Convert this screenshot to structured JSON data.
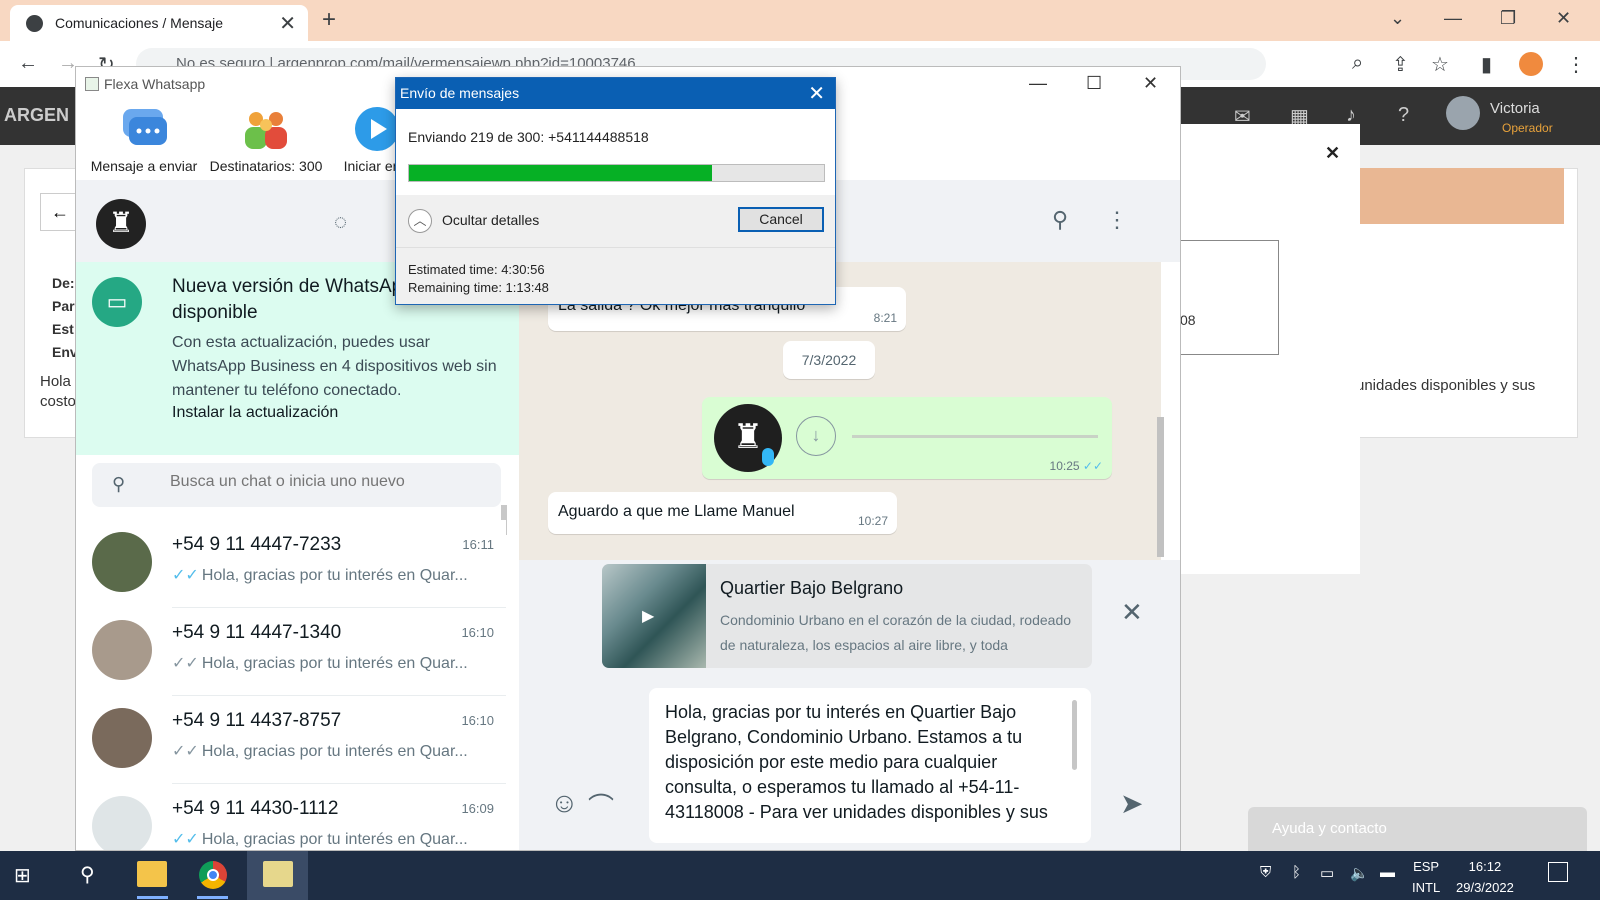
{
  "browser": {
    "tab_title": "Comunicaciones / Mensaje",
    "url": "No es seguro  |  argenprop.com/mail/vermensajewp.php?id=10003746"
  },
  "webapp": {
    "logo": "ARGEN",
    "user_name": "Victoria",
    "user_role": "Operador",
    "field_labels": [
      "De:",
      "Par",
      "Est",
      "Env"
    ],
    "left_text": "Hola\ncosto",
    "right_text": "unidades disponibles y sus",
    "box_text": "08",
    "help_label": "Ayuda y contacto"
  },
  "flexa": {
    "title": "Flexa Whatsapp",
    "toolbar": [
      {
        "label": "Mensaje a enviar",
        "icon": "chat-bubbles-icon"
      },
      {
        "label": "Destinatarios: 300",
        "icon": "people-icon"
      },
      {
        "label": "Iniciar en",
        "icon": "play-icon"
      }
    ]
  },
  "whatsapp": {
    "banner": {
      "title": "Nueva versión de WhatsApp disponible",
      "text": "Con esta actualización, puedes usar WhatsApp Business en 4 dispositivos web sin mantener tu teléfono conectado.",
      "link": "Instalar la actualización"
    },
    "search_placeholder": "Busca un chat o inicia uno nuevo",
    "chats": [
      {
        "name": "+54 9 11 4447-7233",
        "time": "16:11",
        "preview": "Hola, gracias por tu interés en Quar...",
        "read": true,
        "avatar_color": "#5a6a4a"
      },
      {
        "name": "+54 9 11 4447-1340",
        "time": "16:10",
        "preview": "Hola, gracias por tu interés en Quar...",
        "read": false,
        "avatar_color": "#a89a8c"
      },
      {
        "name": "+54 9 11 4437-8757",
        "time": "16:10",
        "preview": "Hola, gracias por tu interés en Quar...",
        "read": false,
        "avatar_color": "#7a6a5c"
      },
      {
        "name": "+54 9 11 4430-1112",
        "time": "16:09",
        "preview": "Hola, gracias por tu interés en Quar...",
        "read": true,
        "avatar_color": "#dfe5e7"
      }
    ],
    "messages": {
      "partial_text": "La salida ? Ok mejor mas tranquilo",
      "partial_time": "8:21",
      "date_chip": "7/3/2022",
      "voice_time": "10:25",
      "last_text": "Aguardo a que me Llame Manuel",
      "last_time": "10:27"
    },
    "link_preview": {
      "title": "Quartier Bajo Belgrano",
      "description": "Condominio Urbano en el corazón de la ciudad, rodeado de naturaleza, los espacios al aire libre, y toda"
    },
    "compose_text": "Hola, gracias por tu interés en Quartier Bajo Belgrano, Condominio Urbano. Estamos a tu disposición por este medio para cualquier consulta, o esperamos tu llamado al +54-11-43118008  - Para ver unidades disponibles y sus"
  },
  "progress_dialog": {
    "title": "Envío de mensajes",
    "status": "Enviando 219 de 300: +541144488518",
    "progress_fraction": 0.73,
    "details_label": "Ocultar detalles",
    "cancel_label": "Cancel",
    "estimated": "Estimated time: 4:30:56",
    "remaining": "Remaining time: 1:13:48"
  },
  "taskbar": {
    "lang_line1": "ESP",
    "lang_line2": "INTL",
    "time": "16:12",
    "date": "29/3/2022"
  }
}
